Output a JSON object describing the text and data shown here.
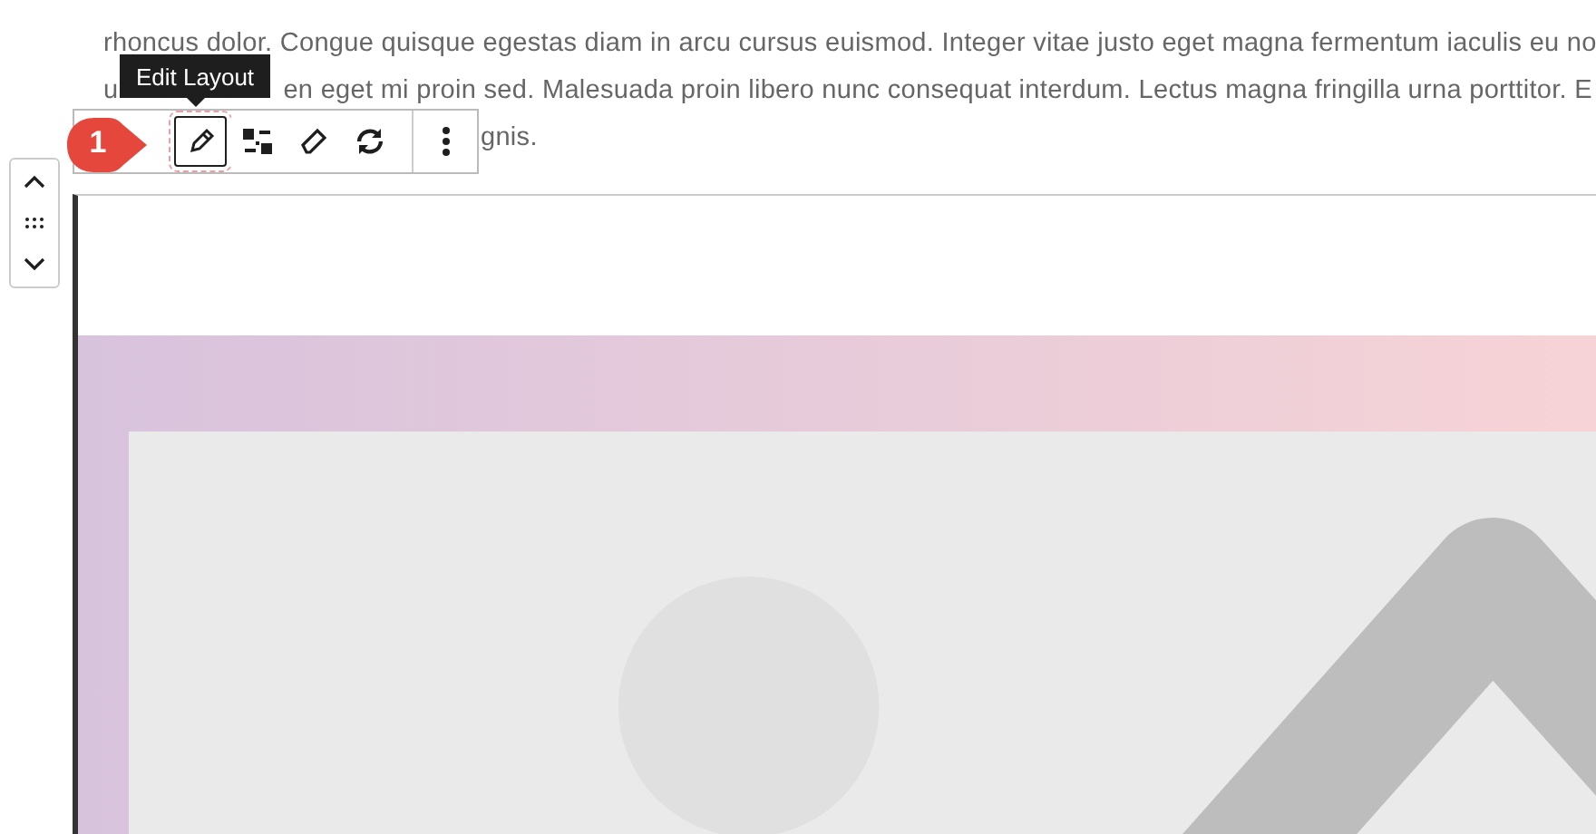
{
  "paragraph": {
    "lines": [
      {
        "parts": [
          "rhoncus dolor. Congue quisque egestas diam in arcu cursus euismod. Integer vitae justo eget magna fermentum iaculis eu no"
        ]
      },
      {
        "parts": [
          "u",
          "en eget mi proin sed. Malesuada proin libero nunc consequat interdum. Lectus magna fringilla urna porttitor. E"
        ]
      },
      {
        "parts": [
          "gnis."
        ]
      }
    ]
  },
  "tooltip": {
    "text": "Edit Layout"
  },
  "callout": {
    "text": "1"
  },
  "toolbar": {
    "buttons": [
      {
        "kind": "pencil",
        "selected": true
      },
      {
        "kind": "transform",
        "selected": false
      },
      {
        "kind": "eraser",
        "selected": false
      },
      {
        "kind": "sync",
        "selected": false
      },
      {
        "kind": "more",
        "selected": false
      }
    ]
  }
}
